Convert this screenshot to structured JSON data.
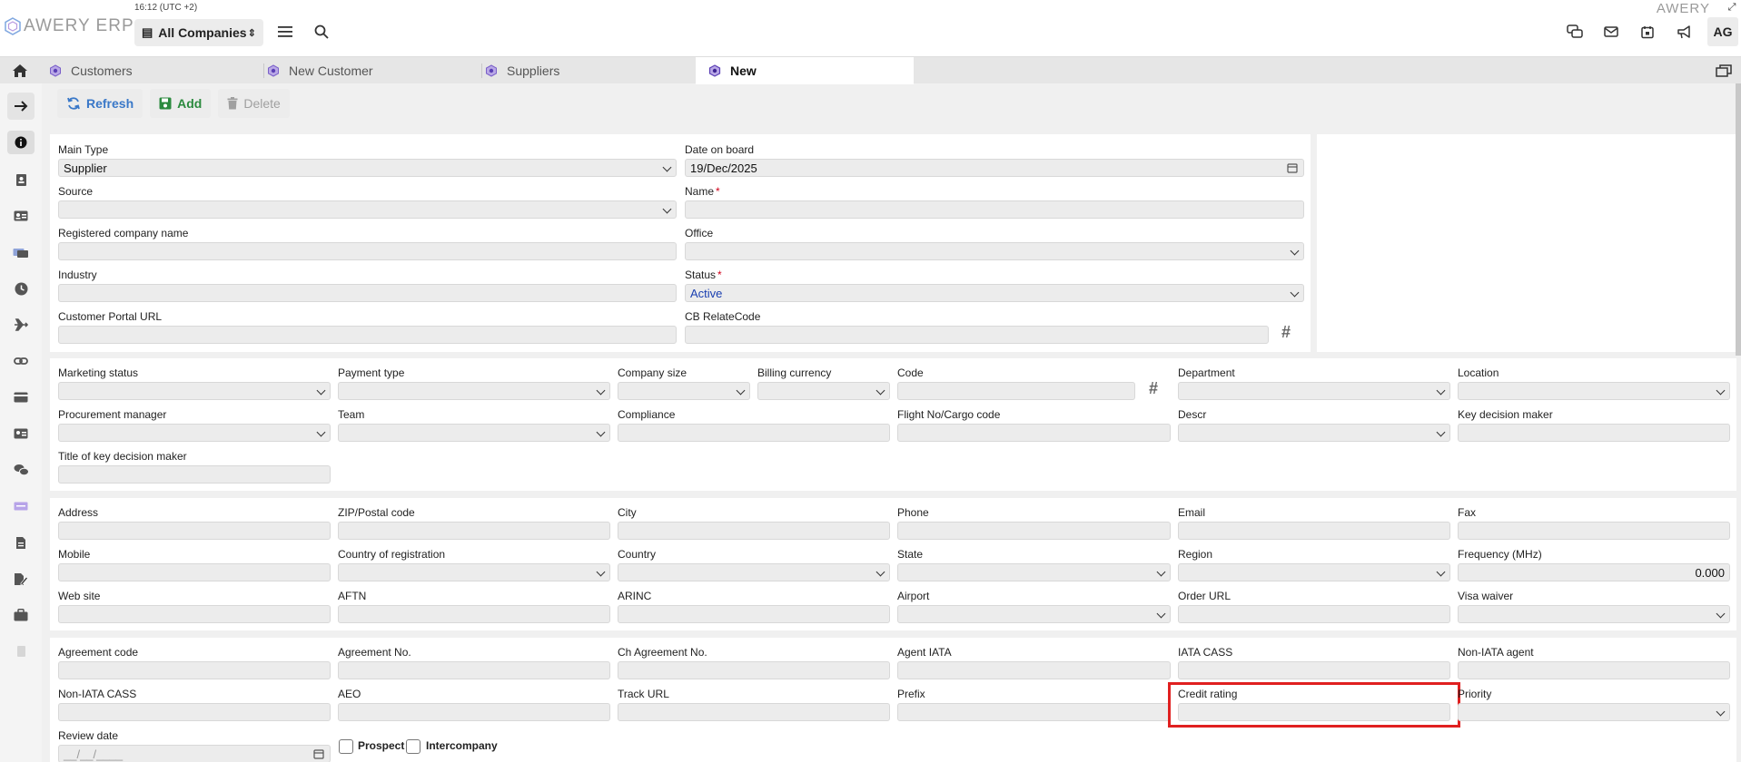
{
  "header": {
    "logo_text": "AWERY ERP",
    "clock": "16:12 (UTC +2)",
    "company": "All Companies",
    "brand_right": "AWERY",
    "avatar": "AG"
  },
  "tabs": [
    {
      "label": "Customers",
      "active": false
    },
    {
      "label": "New Customer",
      "active": false
    },
    {
      "label": "Suppliers",
      "active": false
    },
    {
      "label": "New",
      "active": true
    }
  ],
  "toolbar": {
    "refresh": "Refresh",
    "add": "Add",
    "delete": "Delete"
  },
  "main": {
    "main_type": {
      "label": "Main Type",
      "value": "Supplier"
    },
    "date_on_board": {
      "label": "Date on board",
      "value": "19/Dec/2025"
    },
    "source": {
      "label": "Source",
      "value": ""
    },
    "name": {
      "label": "Name",
      "value": ""
    },
    "registered_company": {
      "label": "Registered company name",
      "value": ""
    },
    "office": {
      "label": "Office",
      "value": ""
    },
    "industry": {
      "label": "Industry",
      "value": ""
    },
    "status": {
      "label": "Status",
      "value": "Active"
    },
    "portal_url": {
      "label": "Customer Portal URL",
      "value": ""
    },
    "cb_relate": {
      "label": "CB RelateCode",
      "value": ""
    }
  },
  "section2": {
    "marketing_status": "Marketing status",
    "payment_type": "Payment type",
    "company_size": "Company size",
    "billing_currency": "Billing currency",
    "code": "Code",
    "department": "Department",
    "location": "Location",
    "procurement_manager": "Procurement manager",
    "team": "Team",
    "compliance": "Compliance",
    "flight_no": "Flight No/Cargo code",
    "descr": "Descr",
    "key_decision_maker": "Key decision maker",
    "title_key_decision_maker": "Title of key decision maker"
  },
  "section3": {
    "address": "Address",
    "zip": "ZIP/Postal code",
    "city": "City",
    "phone": "Phone",
    "email": "Email",
    "fax": "Fax",
    "mobile": "Mobile",
    "country_registration": "Country of registration",
    "country": "Country",
    "state": "State",
    "region": "Region",
    "frequency": "Frequency (MHz)",
    "frequency_value": "0.000",
    "website": "Web site",
    "aftn": "AFTN",
    "arinc": "ARINC",
    "airport": "Airport",
    "order_url": "Order URL",
    "visa_waiver": "Visa waiver"
  },
  "section4": {
    "agreement_code": "Agreement code",
    "agreement_no": "Agreement No.",
    "ch_agreement_no": "Ch Agreement No.",
    "agent_iata": "Agent IATA",
    "iata_cass": "IATA CASS",
    "non_iata_agent": "Non-IATA agent",
    "non_iata_cass": "Non-IATA CASS",
    "aeo": "AEO",
    "track_url": "Track URL",
    "prefix": "Prefix",
    "credit_rating": "Credit rating",
    "priority": "Priority",
    "review_date": "Review date",
    "review_date_placeholder": "__/__/____",
    "prospect": "Prospect",
    "intercompany": "Intercompany"
  }
}
